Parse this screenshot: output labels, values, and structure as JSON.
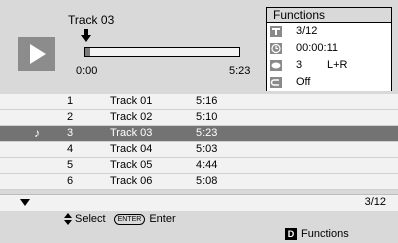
{
  "now_playing": {
    "title": "Track 03",
    "time_start": "0:00",
    "time_end": "5:23",
    "progress": 0.03
  },
  "functions": {
    "title": "Functions",
    "rows": [
      {
        "icon": "title-icon",
        "value": "3/12",
        "value2": ""
      },
      {
        "icon": "clock-icon",
        "value": "00:00:11",
        "value2": ""
      },
      {
        "icon": "audio-icon",
        "value": "3",
        "value2": "L+R"
      },
      {
        "icon": "repeat-icon",
        "value": "Off",
        "value2": ""
      }
    ]
  },
  "tracks": [
    {
      "num": "1",
      "title": "Track 01",
      "duration": "5:16",
      "selected": false
    },
    {
      "num": "2",
      "title": "Track 02",
      "duration": "5:10",
      "selected": false
    },
    {
      "num": "3",
      "title": "Track 03",
      "duration": "5:23",
      "selected": true
    },
    {
      "num": "4",
      "title": "Track 04",
      "duration": "5:03",
      "selected": false
    },
    {
      "num": "5",
      "title": "Track 05",
      "duration": "4:44",
      "selected": false
    },
    {
      "num": "6",
      "title": "Track 06",
      "duration": "5:08",
      "selected": false
    }
  ],
  "pager": {
    "page": "3/12"
  },
  "help": {
    "select_label": "Select",
    "enter_key_label": "ENTER",
    "enter_label": "Enter",
    "functions_key": "D",
    "functions_label": "Functions"
  },
  "colors": {
    "background": "#d9d9d9",
    "selected_row": "#737373",
    "icon_grey": "#8c8c8c"
  }
}
